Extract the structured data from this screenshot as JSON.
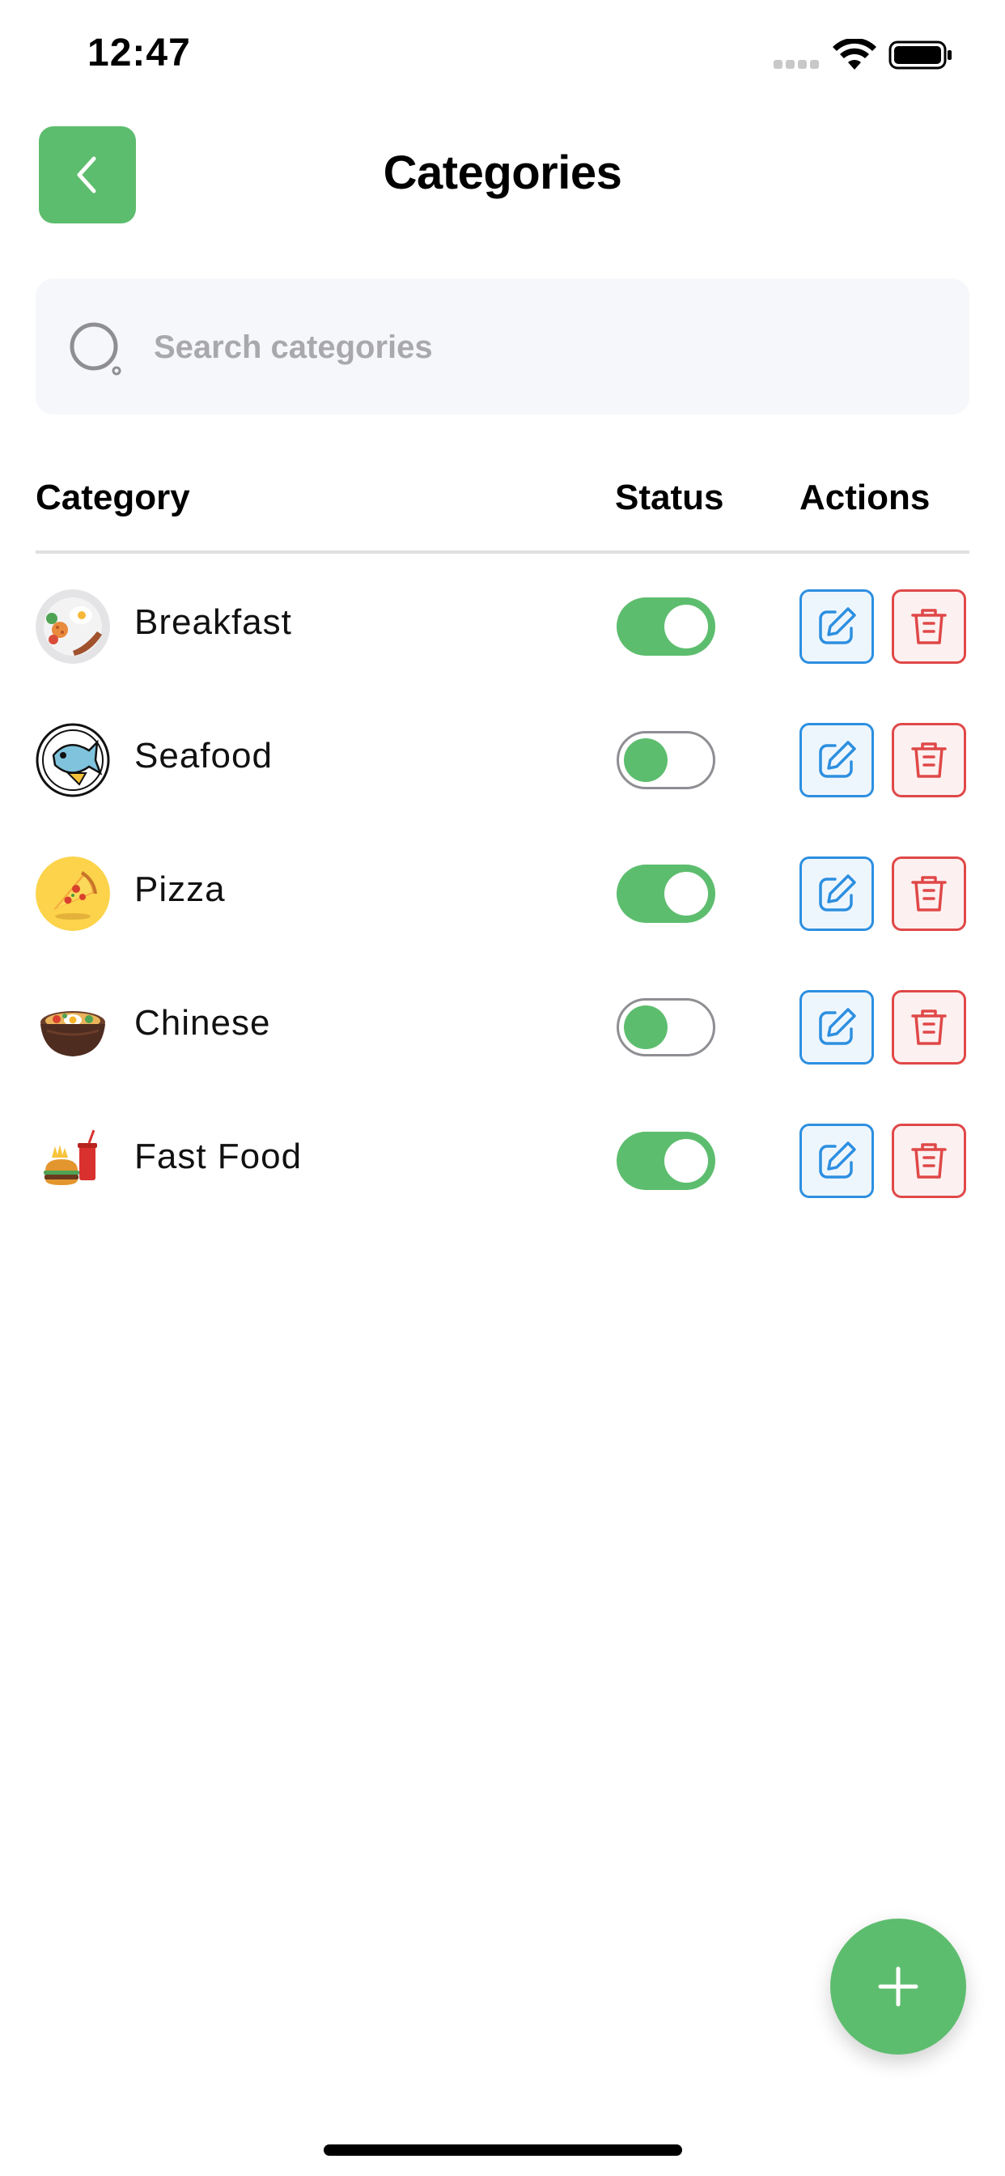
{
  "status_bar": {
    "time": "12:47",
    "icons": [
      "signal-icon",
      "wifi-icon",
      "battery-icon"
    ]
  },
  "header": {
    "title": "Categories",
    "back_icon": "chevron-left-icon"
  },
  "search": {
    "placeholder": "Search categories",
    "value": "",
    "icon": "search-icon"
  },
  "table": {
    "columns": [
      "Category",
      "Status",
      "Actions"
    ],
    "rows": [
      {
        "name": "Breakfast",
        "icon": "breakfast-plate-icon",
        "enabled": true
      },
      {
        "name": "Seafood",
        "icon": "fish-icon",
        "enabled": false
      },
      {
        "name": "Pizza",
        "icon": "pizza-slice-icon",
        "enabled": true
      },
      {
        "name": "Chinese",
        "icon": "noodle-bowl-icon",
        "enabled": false
      },
      {
        "name": "Fast Food",
        "icon": "burger-fries-icon",
        "enabled": true
      }
    ],
    "action_icons": [
      "edit-icon",
      "trash-icon"
    ]
  },
  "fab": {
    "icon": "plus-icon"
  },
  "colors": {
    "accent_green": "#5dbd6e",
    "edit_blue": "#2d8fe0",
    "delete_red": "#e04848",
    "search_bg": "#f6f7fb",
    "divider": "#e0e0e2"
  }
}
